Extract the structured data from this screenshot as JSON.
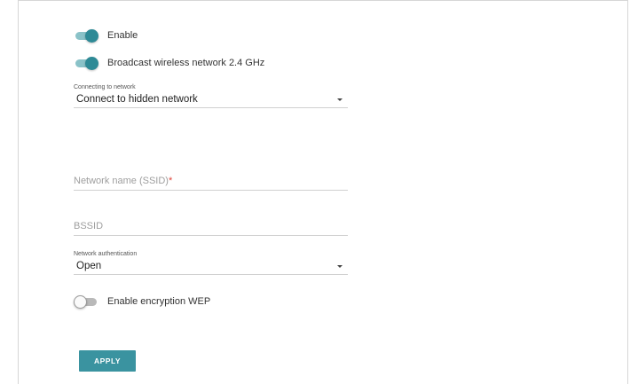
{
  "toggles": {
    "enable": {
      "label": "Enable",
      "on": true
    },
    "broadcast": {
      "label": "Broadcast wireless network 2.4 GHz",
      "on": true
    },
    "encryption": {
      "label": "Enable encryption WEP",
      "on": false
    }
  },
  "connecting": {
    "label": "Connecting to network",
    "value": "Connect to hidden network"
  },
  "ssid": {
    "placeholder": "Network name (SSID)",
    "required_mark": "*"
  },
  "bssid": {
    "placeholder": "BSSID"
  },
  "auth": {
    "label": "Network authentication",
    "value": "Open"
  },
  "apply": {
    "label": "APPLY"
  },
  "colors": {
    "accent": "#2e8a96",
    "required": "#e0463c"
  }
}
